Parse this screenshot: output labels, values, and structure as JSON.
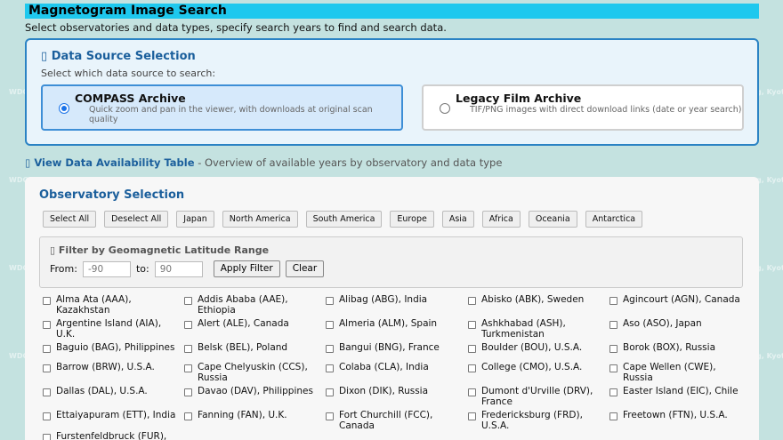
{
  "header": {
    "title": "Magnetogram Image Search",
    "subtitle": "Select observatories and data types, specify search years to find and search data."
  },
  "watermark": "WDC for Geomag, Kyoto",
  "data_source": {
    "title": "Data Source Selection",
    "subtitle": "Select which data source to search:",
    "options": [
      {
        "title": "COMPASS Archive",
        "desc": "Quick zoom and pan in the viewer, with downloads at original scan quality",
        "selected": true
      },
      {
        "title": "Legacy Film Archive",
        "desc": "TIF/PNG images with direct download links (date or year search)",
        "selected": false
      }
    ]
  },
  "availability": {
    "link": "View Data Availability Table",
    "desc": "- Overview of available years by observatory and data type"
  },
  "observatory": {
    "title": "Observatory Selection",
    "buttons": [
      "Select All",
      "Deselect All",
      "Japan",
      "North America",
      "South America",
      "Europe",
      "Asia",
      "Africa",
      "Oceania",
      "Antarctica"
    ],
    "latitude": {
      "title": "Filter by Geomagnetic Latitude Range",
      "from_label": "From:",
      "from_value": "-90",
      "to_label": "to:",
      "to_value": "90",
      "apply": "Apply Filter",
      "clear": "Clear"
    },
    "stations": [
      [
        "Alma Ata (AAA), Kazakhstan",
        "Addis Ababa (AAE), Ethiopia",
        "Alibag (ABG), India",
        "Abisko (ABK), Sweden",
        "Agincourt (AGN), Canada"
      ],
      [
        "Argentine Island (AIA), U.K.",
        "Alert (ALE), Canada",
        "Almeria (ALM), Spain",
        "Ashkhabad (ASH), Turkmenistan",
        "Aso (ASO), Japan"
      ],
      [
        "Baguio (BAG), Philippines",
        "Belsk (BEL), Poland",
        "Bangui (BNG), France",
        "Boulder (BOU), U.S.A.",
        "Borok (BOX), Russia"
      ],
      [
        "Barrow (BRW), U.S.A.",
        "Cape Chelyuskin (CCS), Russia",
        "Colaba (CLA), India",
        "College (CMO), U.S.A.",
        "Cape Wellen (CWE), Russia"
      ],
      [
        "Dallas (DAL), U.S.A.",
        "Davao (DAV), Philippines",
        "Dixon (DIK), Russia",
        "Dumont d'Urville (DRV), France",
        "Easter Island (EIC), Chile"
      ],
      [
        "Ettaiyapuram (ETT), India",
        "Fanning (FAN), U.K.",
        "Fort Churchill (FCC), Canada",
        "Fredericksburg (FRD), U.S.A.",
        "Freetown (FTN), U.S.A."
      ],
      [
        "Furstenfeldbruck (FUR), Germany"
      ]
    ]
  }
}
